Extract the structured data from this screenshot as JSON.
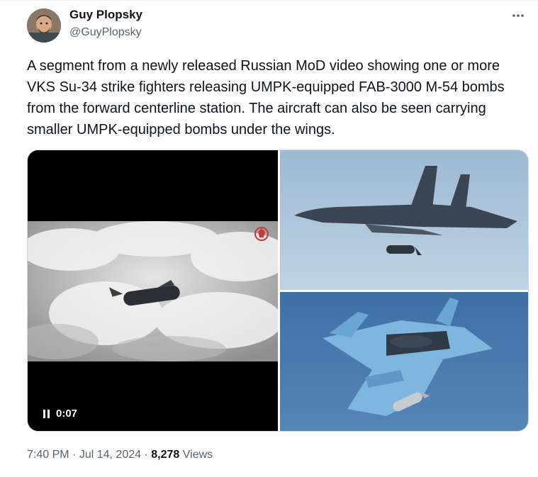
{
  "tweet": {
    "author": {
      "display_name": "Guy Plopsky",
      "handle": "@GuyPlopsky",
      "avatar_icon": "profile-photo"
    },
    "more_icon": "more-horizontal-icon",
    "text": "A segment from a newly released Russian MoD video showing one or more VKS Su-34 strike fighters releasing UMPK-equipped FAB-3000 M-54 bombs from the forward centerline station. The aircraft can also be seen carrying smaller UMPK-equipped bombs under the wings.",
    "media": {
      "video": {
        "time": "0:07",
        "state_icon": "pause-icon",
        "watermark_icon": "ministry-of-defence-emblem-icon"
      },
      "photos": [
        {
          "subject": "Su-34 releasing bomb, side view"
        },
        {
          "subject": "Su-34 underside with bomb release"
        }
      ]
    },
    "meta": {
      "time": "7:40 PM",
      "separator": "·",
      "date": "Jul 14, 2024",
      "views_count": "8,278",
      "views_label": "Views"
    }
  },
  "colors": {
    "text_primary": "#0f1419",
    "text_secondary": "#536471",
    "border": "#cfd9de",
    "sky_top": "#6f98bd",
    "sky_bottom": "#3f74ab"
  }
}
